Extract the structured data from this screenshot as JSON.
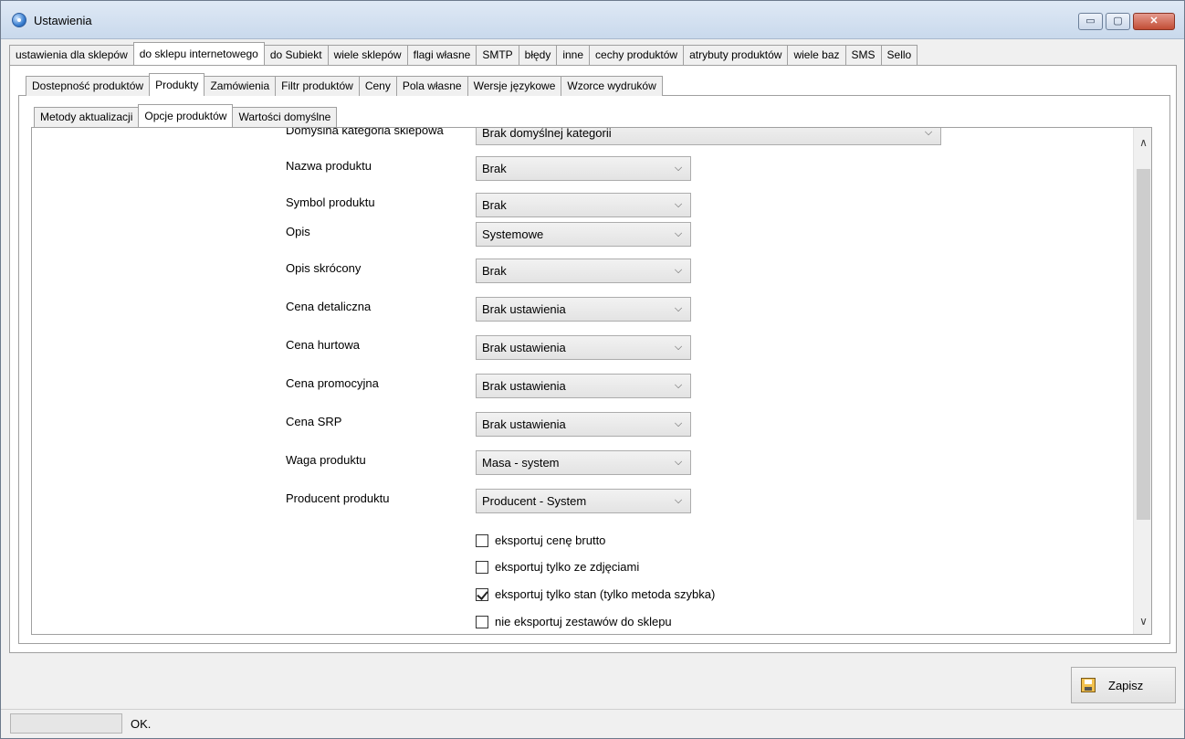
{
  "window": {
    "title": "Ustawienia",
    "min": "▭",
    "max": "▢",
    "close": "✕"
  },
  "tabs1": [
    "ustawienia dla sklepów",
    "do sklepu internetowego",
    "do Subiekt",
    "wiele sklepów",
    "flagi własne",
    "SMTP",
    "błędy",
    "inne",
    "cechy produktów",
    "atrybuty produktów",
    "wiele baz",
    "SMS",
    "Sello"
  ],
  "tabs1_active": 1,
  "tabs2": [
    "Dostepność produktów",
    "Produkty",
    "Zamówienia",
    "Filtr produktów",
    "Ceny",
    "Pola własne",
    "Wersje językowe",
    "Wzorce wydruków"
  ],
  "tabs2_active": 1,
  "tabs3": [
    "Metody aktualizacji",
    "Opcje produktów",
    "Wartości domyślne"
  ],
  "tabs3_active": 1,
  "form": {
    "top_row": {
      "label": "Domyślna kategoria sklepowa",
      "value": "Brak domyślnej kategorii"
    },
    "rows": [
      {
        "label": "Nazwa produktu",
        "value": "Brak"
      },
      {
        "label": "Symbol produktu",
        "value": "Brak"
      },
      {
        "label": "Opis",
        "value": "Systemowe"
      },
      {
        "label": "Opis skrócony",
        "value": "Brak"
      },
      {
        "label": "Cena detaliczna",
        "value": "Brak ustawienia"
      },
      {
        "label": "Cena hurtowa",
        "value": "Brak ustawienia"
      },
      {
        "label": "Cena promocyjna",
        "value": "Brak ustawienia"
      },
      {
        "label": "Cena SRP",
        "value": "Brak ustawienia"
      },
      {
        "label": "Waga produktu",
        "value": "Masa - system"
      },
      {
        "label": "Producent produktu",
        "value": "Producent - System"
      }
    ],
    "checkboxes": [
      {
        "label": "eksportuj cenę brutto",
        "checked": false
      },
      {
        "label": "eksportuj  tylko ze zdjęciami",
        "checked": false
      },
      {
        "label": "eksportuj  tylko stan (tylko metoda szybka)",
        "checked": true
      },
      {
        "label": "nie eksportuj zestawów do sklepu",
        "checked": false
      }
    ]
  },
  "icons": {
    "chevron": "chevron-down-icon",
    "scroll_up": "chevron-up-icon",
    "scroll_down": "chevron-down-icon",
    "save": "floppy-disk-icon"
  },
  "save_label": "Zapisz",
  "status": {
    "text": "OK."
  }
}
